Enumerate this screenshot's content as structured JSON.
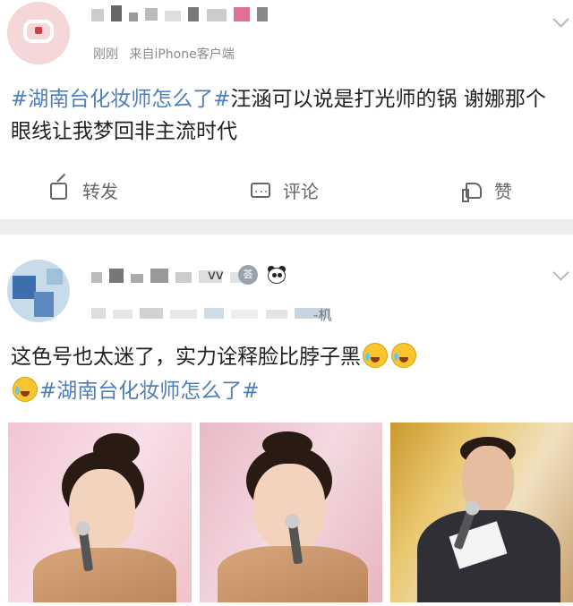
{
  "post1": {
    "meta_time": "刚刚",
    "meta_source": "来自iPhone客户端",
    "text_topic": "#湖南台化妆师怎么了#",
    "text_body": "汪涵可以说是打光师的锅 谢娜那个眼线让我梦回非主流时代",
    "actions": {
      "repost": "转发",
      "comment": "评论",
      "like": "赞"
    }
  },
  "post2": {
    "name_tail": "vv",
    "meta_source": "-机",
    "text_body": "这色号也太迷了，实力诠释脸比脖子黑",
    "text_topic": "#湖南台化妆师怎么了#",
    "emoji_names": [
      "laugh-cry-emoji",
      "laugh-cry-emoji",
      "laugh-cry-emoji"
    ],
    "badge_icon": "member-medal-icon",
    "panda_icon": "panda-icon",
    "images": [
      "woman-with-microphone-photo",
      "woman-with-microphone-closeup-photo",
      "male-host-with-microphone-photo"
    ]
  },
  "colors": {
    "topic_link": "#4f7fb8",
    "separator": "#eeeeee",
    "meta": "#8a8a8a"
  }
}
